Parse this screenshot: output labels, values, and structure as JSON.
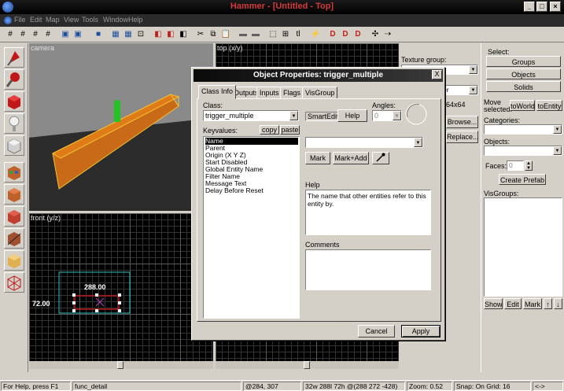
{
  "window": {
    "title": "Hammer - [Untitled - Top]"
  },
  "menu": [
    "File",
    "Edit",
    "Map",
    "View",
    "Tools",
    "Window",
    "Help"
  ],
  "viewports": {
    "camera": {
      "label": "camera"
    },
    "top": {
      "label": "top (x/y)"
    },
    "front": {
      "label": "front (y/z)",
      "width_label": "288.00",
      "height_label": "72.00"
    }
  },
  "texture_panel": {
    "texture_group_label": "Texture group:",
    "size_label": "64x64",
    "browse_label": "Browse...",
    "replace_label": "Replace...",
    "filter_value": "er"
  },
  "right_panel": {
    "select_label": "Select:",
    "groups_btn": "Groups",
    "objects_btn": "Objects",
    "solids_btn": "Solids",
    "move_selected_label": "Move selected:",
    "to_world_btn": "toWorld",
    "to_entity_btn": "toEntity",
    "categories_label": "Categories:",
    "objects_label": "Objects:",
    "faces_label": "Faces:",
    "faces_value": "0",
    "create_prefab_btn": "Create Prefab",
    "visgroups_label": "VisGroups:",
    "show_btn": "Show",
    "edit_btn": "Edit",
    "mark_btn": "Mark",
    "up_btn": "↑",
    "down_btn": "↓"
  },
  "dialog": {
    "title": "Object Properties: trigger_multiple",
    "close": "X",
    "tabs": [
      "Class Info",
      "Outputs",
      "Inputs",
      "Flags",
      "VisGroup"
    ],
    "class_label": "Class:",
    "class_value": "trigger_multiple",
    "smartedit_label": "SmartEdit",
    "help_btn": "Help",
    "angles_label": "Angles:",
    "angles_value": "0",
    "keyvalues_label": "Keyvalues:",
    "copy_btn": "copy",
    "paste_btn": "paste",
    "keyvalues": [
      "Name",
      "Parent",
      "Origin (X Y Z)",
      "Start Disabled",
      "Global Entity Name",
      "Filter Name",
      "Message Text",
      "Delay Before Reset"
    ],
    "mark_btn": "Mark",
    "mark_add_btn": "Mark+Add",
    "help_label": "Help",
    "help_text": "The name that other entities refer to this entity by.",
    "comments_label": "Comments",
    "cancel_btn": "Cancel",
    "apply_btn": "Apply"
  },
  "status": {
    "help": "For Help, press F1",
    "object": "func_detail",
    "cursor": "@284, 307",
    "size": "32w 288l 72h @(288 272 -428)",
    "zoom": "Zoom: 0.52",
    "snap": "Snap: On Grid: 16",
    "extra": "<->"
  },
  "colors": {
    "selection": "#e07b1a",
    "brush_outline": "#f2c230",
    "player": "#22c422"
  }
}
